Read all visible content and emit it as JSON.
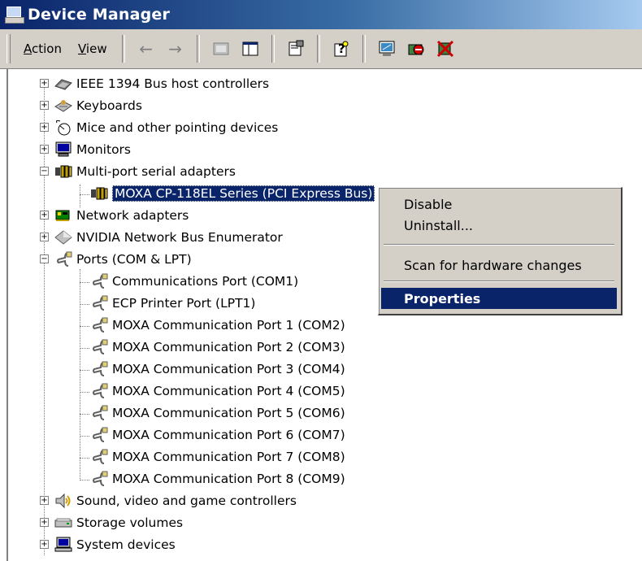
{
  "window": {
    "title": "Device Manager"
  },
  "toolbar": {
    "menus": [
      {
        "label_underlined": "A",
        "label_rest": "ction"
      },
      {
        "label_underlined": "V",
        "label_rest": "iew"
      }
    ]
  },
  "tree": {
    "items": [
      {
        "label": "IEEE 1394 Bus host controllers",
        "icon": "firewire-icon"
      },
      {
        "label": "Keyboards",
        "icon": "keyboard-icon"
      },
      {
        "label": "Mice and other pointing devices",
        "icon": "mouse-icon"
      },
      {
        "label": "Monitors",
        "icon": "monitor-icon"
      },
      {
        "label": "Multi-port serial adapters",
        "icon": "serial-adapter-icon"
      },
      {
        "label": "MOXA CP-118EL Series (PCI Express Bus)",
        "icon": "serial-adapter-icon"
      },
      {
        "label": "Network adapters",
        "icon": "network-adapter-icon"
      },
      {
        "label": "NVIDIA Network Bus Enumerator",
        "icon": "diamond-icon"
      },
      {
        "label": "Ports (COM & LPT)",
        "icon": "port-icon"
      },
      {
        "label": "Communications Port (COM1)",
        "icon": "port-icon"
      },
      {
        "label": "ECP Printer Port (LPT1)",
        "icon": "port-icon"
      },
      {
        "label": "MOXA Communication Port 1 (COM2)",
        "icon": "port-icon"
      },
      {
        "label": "MOXA Communication Port 2 (COM3)",
        "icon": "port-icon"
      },
      {
        "label": "MOXA Communication Port 3 (COM4)",
        "icon": "port-icon"
      },
      {
        "label": "MOXA Communication Port 4 (COM5)",
        "icon": "port-icon"
      },
      {
        "label": "MOXA Communication Port 5 (COM6)",
        "icon": "port-icon"
      },
      {
        "label": "MOXA Communication Port 6 (COM7)",
        "icon": "port-icon"
      },
      {
        "label": "MOXA Communication Port 7 (COM8)",
        "icon": "port-icon"
      },
      {
        "label": "MOXA Communication Port 8 (COM9)",
        "icon": "port-icon"
      },
      {
        "label": "Sound, video and game controllers",
        "icon": "speaker-icon"
      },
      {
        "label": "Storage volumes",
        "icon": "drive-icon"
      },
      {
        "label": "System devices",
        "icon": "computer-icon"
      }
    ]
  },
  "context_menu": {
    "items": [
      "Disable",
      "Uninstall...",
      "Scan for hardware changes",
      "Properties"
    ]
  },
  "colors": {
    "titlebar": "#0a246a",
    "face": "#d4d0c8",
    "selection": "#0a246a"
  }
}
